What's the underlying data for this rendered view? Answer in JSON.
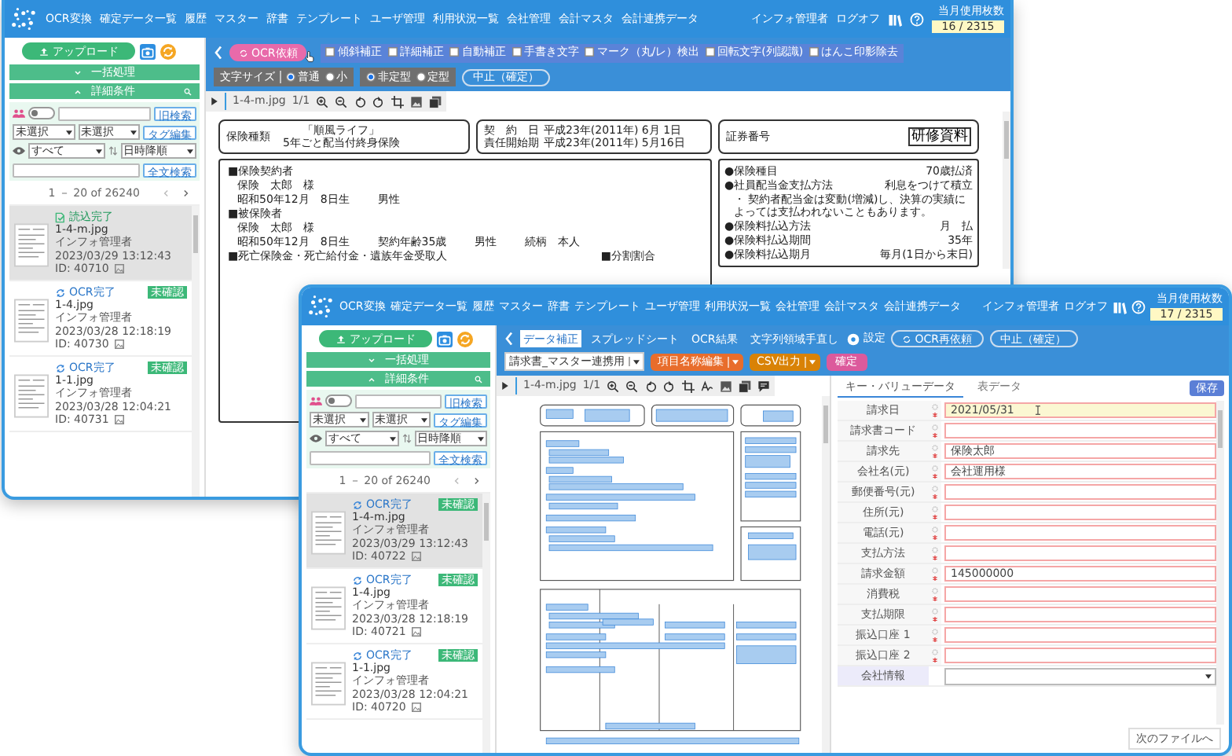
{
  "windows": [
    {
      "kind": "back",
      "nav": [
        "OCR変換",
        "確定データ一覧",
        "履歴",
        "マスター",
        "辞書",
        "テンプレート",
        "ユーザ管理",
        "利用状況一覧",
        "会社管理",
        "会計マスタ",
        "会計連携データ"
      ],
      "user": "インフォ管理者",
      "logout": "ログオフ",
      "usage_label": "当月使用枚数",
      "usage": "16 / 2315",
      "sidebar": {
        "upload": "アップロード",
        "batch": "一括処理",
        "filter": "詳細条件",
        "old_search": "旧検索",
        "select_1": "未選択",
        "select_2": "未選択",
        "tag_edit": "タグ編集",
        "visibility": "すべて",
        "sort": "日時降順",
        "fulltext": "全文検索",
        "range": "1 － 20 of 26240",
        "files": [
          {
            "kind": "loaded",
            "status": "読込完了",
            "name": "1-4-m.jpg",
            "user": "インフォ管理者",
            "date": "2023/03/29 13:12:43",
            "id": "ID: 40710",
            "selected": true
          },
          {
            "kind": "ocr",
            "status": "OCR完了",
            "name": "1-4.jpg",
            "badge": "未確認",
            "user": "インフォ管理者",
            "date": "2023/03/28 12:18:19",
            "id": "ID: 40730",
            "selected": false
          },
          {
            "kind": "ocr",
            "status": "OCR完了",
            "name": "1-1.jpg",
            "badge": "未確認",
            "user": "インフォ管理者",
            "date": "2023/03/28 12:04:21",
            "id": "ID: 40731",
            "selected": false
          }
        ],
        "toggle_on": false
      },
      "toolbar": {
        "ocr_button": "OCR依頼",
        "options": [
          {
            "label": "傾斜補正",
            "checked": false
          },
          {
            "label": "詳細補正",
            "checked": false
          },
          {
            "label": "自動補正",
            "checked": false
          },
          {
            "label": "手書き文字",
            "checked": false
          },
          {
            "label": "マーク（丸/レ）検出",
            "checked": false
          },
          {
            "label": "回転文字(列認識)",
            "checked": false
          },
          {
            "label": "はんこ印影除去",
            "checked": false
          }
        ],
        "font_size_label": "文字サイズ",
        "font_sizes": [
          {
            "label": "普通",
            "selected": true
          },
          {
            "label": "小",
            "selected": false
          }
        ],
        "layouts": [
          {
            "label": "非定型",
            "selected": true
          },
          {
            "label": "定型",
            "selected": false
          }
        ],
        "stop_button": "中止（確定）"
      },
      "viewer": {
        "file": "1-4-m.jpg",
        "page": "1/1"
      },
      "document": {
        "type_label": "保険種類",
        "product": "「順風ライフ」",
        "product_sub": "5年ごと配当付終身保険",
        "dates": [
          {
            "label": "契　約　日",
            "value": "平成23年(2011年)  6月  1日"
          },
          {
            "label": "責任開始期",
            "value": "平成23年(2011年)  5月16日"
          }
        ],
        "cert_label": "証券番号",
        "cert_stamp": "研修資料",
        "sections": [
          {
            "heading": "■保険契約者",
            "lines": [
              [
                "保険　太郎　様"
              ],
              [
                "昭和50年12月　8日生",
                "男性"
              ]
            ]
          },
          {
            "heading": "■被保険者",
            "lines": [
              [
                "保険　太郎　様"
              ],
              [
                "昭和50年12月　8日生",
                "契約年齢35歳",
                "男性",
                "続柄　本人"
              ]
            ]
          },
          {
            "heading": "■死亡保険金・死亡給付金・遺族年金受取人"
          }
        ],
        "split_label": "■分割割合",
        "terms": [
          {
            "kind": "pair",
            "label": "●保険種目",
            "value": "70歳払済"
          },
          {
            "kind": "pair",
            "label": "●社員配当金支払方法",
            "value": "利息をつけて積立"
          },
          {
            "kind": "note",
            "text": "・ 契約者配当金は変動(増減)し、決算の実績によっては支払われないこともあります。"
          },
          {
            "kind": "pair",
            "label": "●保険料払込方法",
            "value": "月　払"
          },
          {
            "kind": "pair",
            "label": "●保険料払込期間",
            "value": "35年"
          },
          {
            "kind": "pair",
            "label": "●保険料払込期月",
            "value": "毎月(1日から末日)"
          }
        ]
      }
    },
    {
      "kind": "front",
      "nav": [
        "OCR変換",
        "確定データ一覧",
        "履歴",
        "マスター",
        "辞書",
        "テンプレート",
        "ユーザ管理",
        "利用状況一覧",
        "会社管理",
        "会計マスタ",
        "会計連携データ"
      ],
      "user": "インフォ管理者",
      "logout": "ログオフ",
      "usage_label": "当月使用枚数",
      "usage": "17 / 2315",
      "sidebar": {
        "upload": "アップロード",
        "batch": "一括処理",
        "filter": "詳細条件",
        "old_search": "旧検索",
        "select_1": "未選択",
        "select_2": "未選択",
        "tag_edit": "タグ編集",
        "visibility": "すべて",
        "sort": "日時降順",
        "fulltext": "全文検索",
        "range": "1 － 20 of 26240",
        "files": [
          {
            "kind": "ocr",
            "status": "OCR完了",
            "name": "1-4-m.jpg",
            "badge": "未確認",
            "user": "インフォ管理者",
            "date": "2023/03/29 13:12:43",
            "id": "ID: 40722",
            "selected": true
          },
          {
            "kind": "ocr",
            "status": "OCR完了",
            "name": "1-4.jpg",
            "badge": "未確認",
            "user": "インフォ管理者",
            "date": "2023/03/28 12:18:19",
            "id": "ID: 40721",
            "selected": false
          },
          {
            "kind": "ocr",
            "status": "OCR完了",
            "name": "1-1.jpg",
            "badge": "未確認",
            "user": "インフォ管理者",
            "date": "2023/03/28 12:04:21",
            "id": "ID: 40720",
            "selected": false
          }
        ],
        "toggle_on": false
      },
      "toolbar": {
        "tabs": [
          {
            "label": "データ補正",
            "selected": true
          },
          {
            "label": "スプレッドシート",
            "selected": false
          },
          {
            "label": "OCR結果",
            "selected": false
          },
          {
            "label": "文字列領域手直し",
            "selected": false
          }
        ],
        "settings": "設定",
        "reocr_button": "OCR再依頼",
        "stop_button": "中止（確定）",
        "template": "請求書_マスター連携用",
        "edit_button": "項目名称編集",
        "csv_button": "CSV出力",
        "confirm_button": "確定"
      },
      "viewer": {
        "file": "1-4-m.jpg",
        "page": "1/1"
      },
      "panel": {
        "tabs": [
          {
            "label": "キー・バリューデータ",
            "selected": true
          },
          {
            "label": "表データ",
            "selected": false
          }
        ],
        "save_button": "保存",
        "fields": [
          {
            "kind": "text",
            "label": "請求日",
            "value": "2021/05/31",
            "focused": true
          },
          {
            "kind": "text",
            "label": "請求書コード",
            "focused": false
          },
          {
            "kind": "text",
            "label": "請求先",
            "value": "保険太郎",
            "focused": false
          },
          {
            "kind": "text",
            "label": "会社名(元)",
            "value": "会社運用様",
            "focused": false
          },
          {
            "kind": "text",
            "label": "郵便番号(元)",
            "focused": false
          },
          {
            "kind": "text",
            "label": "住所(元)",
            "focused": false
          },
          {
            "kind": "text",
            "label": "電話(元)",
            "focused": false
          },
          {
            "kind": "text",
            "label": "支払方法",
            "focused": false
          },
          {
            "kind": "text",
            "label": "請求金額",
            "value": "145000000",
            "focused": false
          },
          {
            "kind": "text",
            "label": "消費税",
            "focused": false
          },
          {
            "kind": "text",
            "label": "支払期限",
            "focused": false
          },
          {
            "kind": "text",
            "label": "振込口座 1",
            "focused": false
          },
          {
            "kind": "text",
            "label": "振込口座 2",
            "focused": false
          },
          {
            "kind": "select",
            "label": "会社情報",
            "focused": false
          }
        ],
        "next_button": "次のファイルへ"
      }
    }
  ]
}
